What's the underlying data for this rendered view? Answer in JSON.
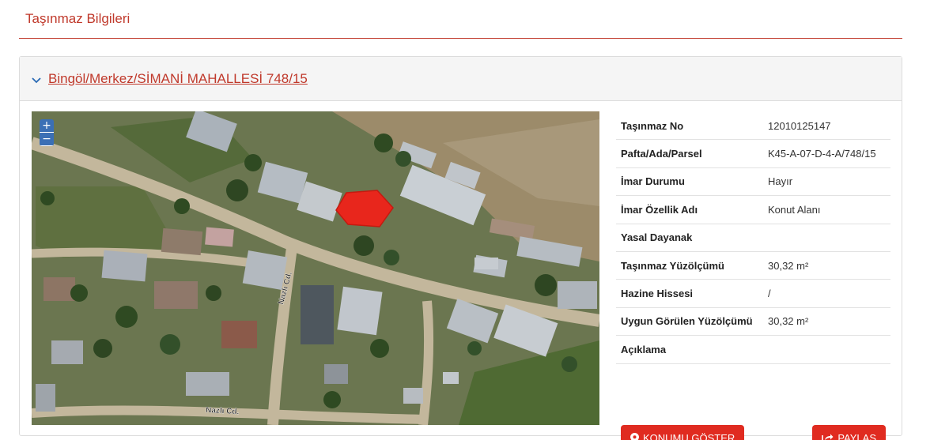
{
  "section": {
    "title": "Taşınmaz Bilgileri"
  },
  "panel": {
    "header_link": "Bingöl/Merkez/SİMANİ MAHALLESİ 748/15"
  },
  "map": {
    "zoom_in": "+",
    "zoom_out": "−",
    "street_label_1": "Nazlı Cd.",
    "street_label_2": "Nazlı Cd."
  },
  "details": [
    {
      "key": "Taşınmaz No",
      "value": "12010125147"
    },
    {
      "key": "Pafta/Ada/Parsel",
      "value": "K45-A-07-D-4-A/748/15"
    },
    {
      "key": "İmar Durumu",
      "value": "Hayır"
    },
    {
      "key": "İmar Özellik Adı",
      "value": "Konut Alanı"
    },
    {
      "key": "Yasal Dayanak",
      "value": ""
    },
    {
      "key": "Taşınmaz Yüzölçümü",
      "value": "30,32 m²"
    },
    {
      "key": "Hazine Hissesi",
      "value": "/"
    },
    {
      "key": "Uygun Görülen Yüzölçümü",
      "value": "30,32 m²"
    },
    {
      "key": "Açıklama",
      "value": ""
    }
  ],
  "buttons": {
    "show_location": "KONUMU GÖSTER",
    "share": "PAYLAŞ"
  },
  "colors": {
    "accent": "#c0392b",
    "button": "#e02b20",
    "parcel": "#e8261c",
    "zoom": "#3b6fb5"
  }
}
